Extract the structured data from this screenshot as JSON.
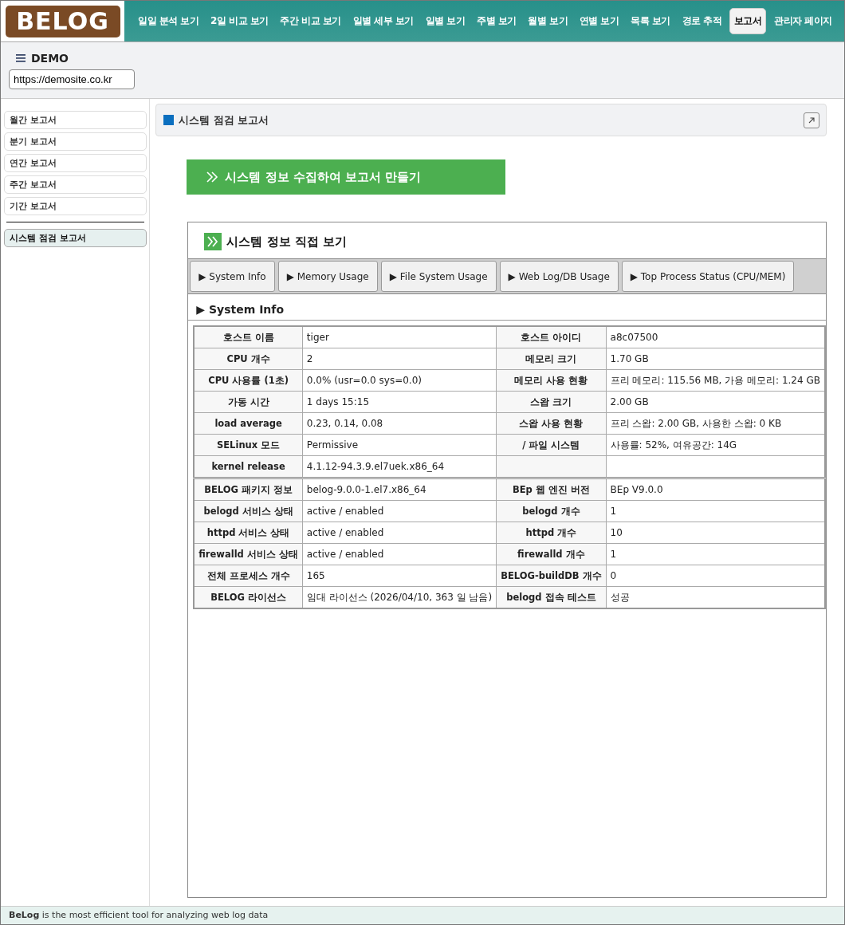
{
  "logo": "BELOG",
  "nav": [
    {
      "label": "일일 분석 보기",
      "selected": false
    },
    {
      "label": "2일 비교 보기",
      "selected": false
    },
    {
      "label": "주간 비교 보기",
      "selected": false
    },
    {
      "label": "일별 세부 보기",
      "selected": false
    },
    {
      "label": "일별 보기",
      "selected": false
    },
    {
      "label": "주별 보기",
      "selected": false
    },
    {
      "label": "월별 보기",
      "selected": false
    },
    {
      "label": "연별 보기",
      "selected": false
    },
    {
      "label": "목록 보기",
      "selected": false
    },
    {
      "label": "경로 추적",
      "selected": false
    },
    {
      "label": "보고서",
      "selected": true
    },
    {
      "label": "관리자 페이지",
      "selected": false
    }
  ],
  "site": {
    "name": "DEMO",
    "url": "https://demosite.co.kr"
  },
  "sidebar": {
    "groups": [
      [
        {
          "label": "월간 보고서",
          "selected": false
        },
        {
          "label": "분기 보고서",
          "selected": false
        },
        {
          "label": "연간 보고서",
          "selected": false
        },
        {
          "label": "주간 보고서",
          "selected": false
        },
        {
          "label": "기간 보고서",
          "selected": false
        }
      ],
      [
        {
          "label": "시스템 점검 보고서",
          "selected": true
        }
      ]
    ]
  },
  "panel": {
    "title": "시스템 점검 보고서",
    "action_button": "시스템 정보 수집하여 보고서 만들기",
    "box_title": "시스템 정보 직접 보기",
    "tabs": [
      {
        "label": "▶ System Info"
      },
      {
        "label": "▶ Memory Usage"
      },
      {
        "label": "▶ File System Usage"
      },
      {
        "label": "▶ Web Log/DB Usage"
      },
      {
        "label": "▶ Top Process Status (CPU/MEM)"
      }
    ],
    "section_title": "▶ System Info",
    "table": [
      [
        {
          "cells": [
            "호스트 이름",
            "tiger",
            "호스트 아이디",
            "a8c07500"
          ]
        },
        {
          "cells": [
            "CPU 개수",
            "2",
            "메모리 크기",
            "1.70 GB"
          ]
        },
        {
          "cells": [
            "CPU 사용률 (1초)",
            "0.0% (usr=0.0 sys=0.0)",
            "메모리 사용 현황",
            "프리 메모리: 115.56 MB, 가용 메모리: 1.24 GB"
          ]
        },
        {
          "cells": [
            "가동 시간",
            "1 days 15:15",
            "스왑 크기",
            "2.00 GB"
          ]
        },
        {
          "cells": [
            "load average",
            "0.23, 0.14, 0.08",
            "스왑 사용 현황",
            "프리 스왑: 2.00 GB, 사용한 스왑: 0 KB"
          ]
        },
        {
          "cells": [
            "SELinux 모드",
            "Permissive",
            "/ 파일 시스템",
            "사용률: 52%, 여유공간: 14G"
          ]
        },
        {
          "cells": [
            "kernel release",
            "4.1.12-94.3.9.el7uek.x86_64"
          ]
        }
      ],
      [
        {
          "cells": [
            "BELOG 패키지 정보",
            "belog-9.0.0-1.el7.x86_64",
            "BEp 웹 엔진 버전",
            "BEp V9.0.0"
          ]
        },
        {
          "cells": [
            "belogd 서비스 상태",
            "active / enabled",
            "belogd 개수",
            "1"
          ]
        },
        {
          "cells": [
            "httpd 서비스 상태",
            "active / enabled",
            "httpd 개수",
            "10"
          ]
        },
        {
          "cells": [
            "firewalld 서비스 상태",
            "active / enabled",
            "firewalld 개수",
            "1"
          ]
        },
        {
          "cells": [
            "전체 프로세스 개수",
            "165",
            "BELOG-buildDB 개수",
            "0"
          ]
        },
        {
          "cells": [
            "BELOG 라이선스",
            "임대 라이선스 (2026/04/10, 363 일 남음)",
            "belogd 접속 테스트",
            "성공"
          ]
        }
      ]
    ]
  },
  "footer": "**BeLog** is the most efficient tool for analyzing web log data"
}
